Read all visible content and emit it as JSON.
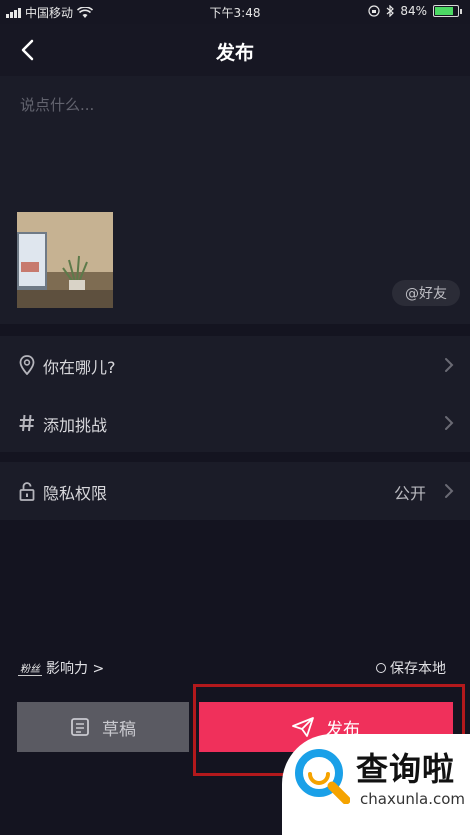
{
  "status": {
    "carrier": "中国移动",
    "time": "下午3:48",
    "battery": "84%",
    "battery_level": 0.84
  },
  "header": {
    "title": "发布"
  },
  "compose": {
    "placeholder": "说点什么...",
    "friends_label": "@好友"
  },
  "options": [
    {
      "label": "你在哪儿?",
      "icon": "location-pin-icon"
    },
    {
      "label": "添加挑战",
      "icon": "hashtag-icon"
    }
  ],
  "privacy": {
    "label": "隐私权限",
    "value": "公开",
    "icon": "unlock-icon"
  },
  "footer": {
    "fans_badge": "粉丝",
    "influence_label": "影响力 >",
    "save_local_label": "保存本地"
  },
  "buttons": {
    "draft_label": "草稿",
    "publish_label": "发布"
  },
  "watermark": {
    "cn": "查询啦",
    "en": "chaxunla.com"
  },
  "colors": {
    "accent": "#f0305b",
    "highlight": "#b3191c",
    "background": "#141420"
  }
}
